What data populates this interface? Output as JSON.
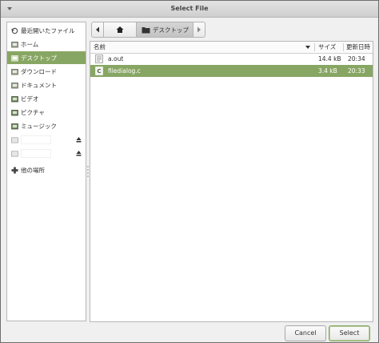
{
  "window": {
    "title": "Select File"
  },
  "sidebar": {
    "items": [
      {
        "label": "最近開いたファイル",
        "icon": "recent-icon"
      },
      {
        "label": "ホーム",
        "icon": "home-folder-icon"
      },
      {
        "label": "デスクトップ",
        "icon": "desktop-folder-icon",
        "selected": true
      },
      {
        "label": "ダウンロード",
        "icon": "download-folder-icon"
      },
      {
        "label": "ドキュメント",
        "icon": "documents-folder-icon"
      },
      {
        "label": "ビデオ",
        "icon": "video-folder-icon"
      },
      {
        "label": "ピクチャ",
        "icon": "pictures-folder-icon"
      },
      {
        "label": "ミュージック",
        "icon": "music-folder-icon"
      },
      {
        "label": "",
        "icon": "drive-icon"
      },
      {
        "label": "",
        "icon": "drive-icon"
      },
      {
        "label": "他の場所",
        "icon": "other-locations-icon"
      }
    ]
  },
  "pathbar": {
    "current": "デスクトップ"
  },
  "filelist": {
    "columns": {
      "name": "名前",
      "size": "サイズ",
      "modified": "更新日時"
    },
    "rows": [
      {
        "name": "a.out",
        "size": "14.4 kB",
        "modified": "20:34",
        "icon": "executable-file-icon"
      },
      {
        "name": "filedialog.c",
        "size": "3.4 kB",
        "modified": "20:33",
        "icon": "c-source-file-icon",
        "selected": true
      }
    ]
  },
  "buttons": {
    "cancel": "Cancel",
    "select": "Select"
  },
  "colors": {
    "selection": "#88a663",
    "window_bg": "#f0f0f0"
  }
}
